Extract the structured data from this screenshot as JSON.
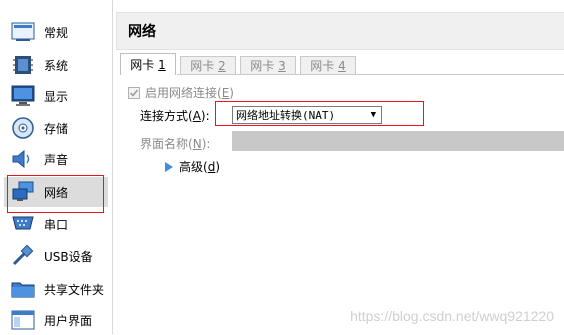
{
  "sidebar": {
    "items": [
      {
        "label": "常规",
        "icon": "general-settings-icon"
      },
      {
        "label": "系统",
        "icon": "system-chip-icon"
      },
      {
        "label": "显示",
        "icon": "display-monitor-icon"
      },
      {
        "label": "存储",
        "icon": "storage-disc-icon"
      },
      {
        "label": "声音",
        "icon": "audio-speaker-icon"
      },
      {
        "label": "网络",
        "icon": "network-icon",
        "selected": true
      },
      {
        "label": "串口",
        "icon": "serial-port-icon"
      },
      {
        "label": "USB设备",
        "icon": "usb-icon"
      },
      {
        "label": "共享文件夹",
        "icon": "shared-folder-icon"
      },
      {
        "label": "用户界面",
        "icon": "user-interface-icon"
      }
    ]
  },
  "panel": {
    "title": "网络"
  },
  "tabs": [
    {
      "label": "网卡",
      "num": "1",
      "active": true
    },
    {
      "label": "网卡",
      "num": "2"
    },
    {
      "label": "网卡",
      "num": "3"
    },
    {
      "label": "网卡",
      "num": "4"
    }
  ],
  "adapter": {
    "enable_label": "启用网络连接",
    "enable_key": "E",
    "enabled": true,
    "attached_label": "连接方式",
    "attached_key": "A",
    "attached_value": "网络地址转换(NAT)",
    "name_label": "界面名称",
    "name_key": "N",
    "advanced_label": "高级",
    "advanced_key": "d"
  },
  "watermark": "https://blog.csdn.net/wwq921220",
  "colors": {
    "highlight_box": "#e8141f",
    "selected_bg": "#dcdcdc",
    "accent": "#3a8ee6"
  }
}
